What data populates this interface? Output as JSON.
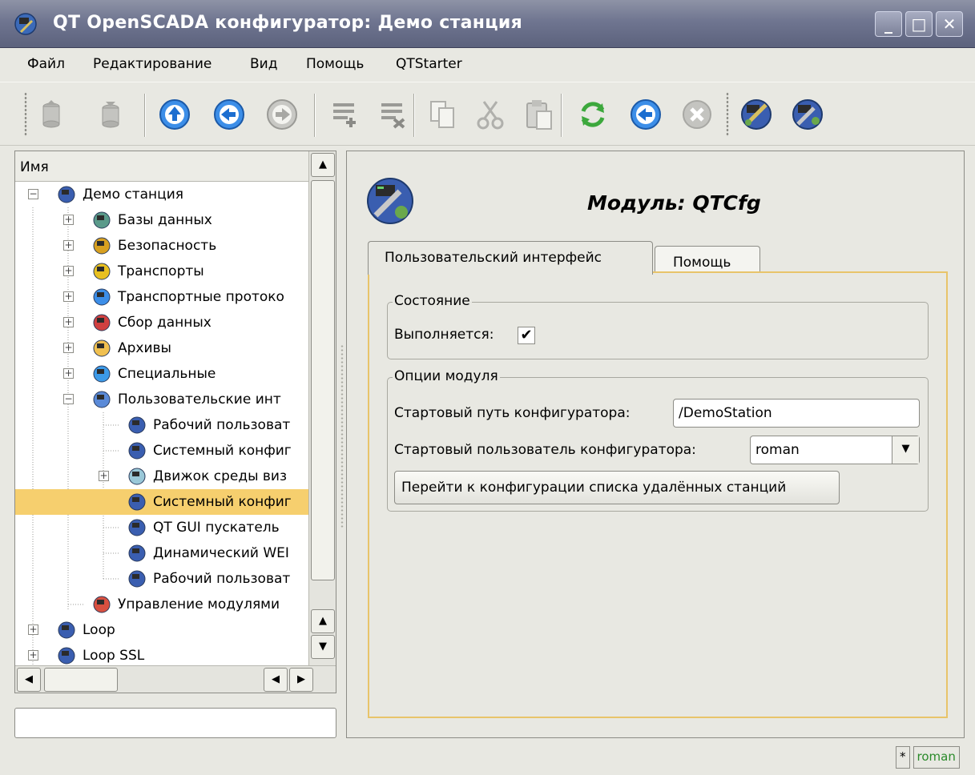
{
  "window": {
    "title": "QT OpenSCADA конфигуратор: Демо станция",
    "controls": [
      "_",
      "□",
      "✕"
    ]
  },
  "menu": [
    {
      "label": "Файл"
    },
    {
      "label": "Редактирование"
    },
    {
      "label": "Вид"
    },
    {
      "label": "Помощь"
    },
    {
      "label": "QTStarter"
    }
  ],
  "toolbar": {
    "buttons": [
      {
        "icon": "db-load-icon"
      },
      {
        "icon": "db-save-icon"
      },
      {
        "icon": "up-icon"
      },
      {
        "icon": "back-icon"
      },
      {
        "icon": "forward-icon"
      },
      {
        "icon": "add-item-icon"
      },
      {
        "icon": "delete-item-icon"
      },
      {
        "icon": "copy-icon"
      },
      {
        "icon": "cut-icon"
      },
      {
        "icon": "paste-icon"
      },
      {
        "icon": "refresh-icon"
      },
      {
        "icon": "start-icon"
      },
      {
        "icon": "stop-icon"
      },
      {
        "icon": "user-interface-icon"
      },
      {
        "icon": "system-configurator-icon"
      }
    ]
  },
  "tree": {
    "header": "Имя",
    "items": [
      {
        "label": "Демо станция",
        "expander": "⊟",
        "icon": "station-icon"
      },
      {
        "label": "Базы данных",
        "expander": "⊞",
        "icon": "database-icon"
      },
      {
        "label": "Безопасность",
        "expander": "⊞",
        "icon": "security-icon"
      },
      {
        "label": "Транспорты",
        "expander": "⊞",
        "icon": "transport-icon"
      },
      {
        "label": "Транспортные протоко",
        "expander": "⊞",
        "icon": "protocol-icon"
      },
      {
        "label": "Сбор данных",
        "expander": "⊞",
        "icon": "data-acquisition-icon"
      },
      {
        "label": "Архивы",
        "expander": "⊞",
        "icon": "archive-icon"
      },
      {
        "label": "Специальные",
        "expander": "⊞",
        "icon": "special-icon"
      },
      {
        "label": "Пользовательские инт",
        "expander": "⊟",
        "icon": "ui-monitor-icon"
      },
      {
        "label": "Рабочий пользоват",
        "expander": "",
        "icon": "ui-module-icon"
      },
      {
        "label": "Системный конфиг",
        "expander": "",
        "icon": "ui-module-icon"
      },
      {
        "label": "Движок среды виз",
        "expander": "⊞",
        "icon": "vis-engine-icon"
      },
      {
        "label": "Системный конфиг",
        "expander": "",
        "icon": "ui-module-icon",
        "selected": true
      },
      {
        "label": "QT GUI пускатель",
        "expander": "",
        "icon": "ui-module-icon"
      },
      {
        "label": "Динамический WEI",
        "expander": "",
        "icon": "ui-module-icon"
      },
      {
        "label": "Рабочий пользоват",
        "expander": "",
        "icon": "ui-module-icon"
      },
      {
        "label": "Управление модулями",
        "expander": "",
        "icon": "module-manager-icon"
      },
      {
        "label": "Loop",
        "expander": "⊞",
        "icon": "station-icon"
      },
      {
        "label": "Loop SSL",
        "expander": "⊞",
        "icon": "station-icon"
      }
    ]
  },
  "module": {
    "title": "Модуль: QTCfg",
    "tabs": [
      "Пользовательский интерфейс",
      "Помощь"
    ],
    "state_group": "Состояние",
    "running_label": "Выполняется:",
    "running_checked": true,
    "running_mark": "✔",
    "options_group": "Опции модуля",
    "start_path_label": "Стартовый путь конфигуратора:",
    "start_path_value": "/DemoStation",
    "start_user_label": "Стартовый пользователь конфигуратора:",
    "start_user_value": "roman",
    "go_button": "Перейти к конфигурации списка удалённых станций"
  },
  "statusbar": {
    "modified": "*",
    "user": "roman"
  },
  "colors": {
    "selection": "#f6cf6e",
    "tab_frame": "#e8c46a",
    "titlebar": "#6f7590",
    "user_text": "#2a8a2a"
  }
}
